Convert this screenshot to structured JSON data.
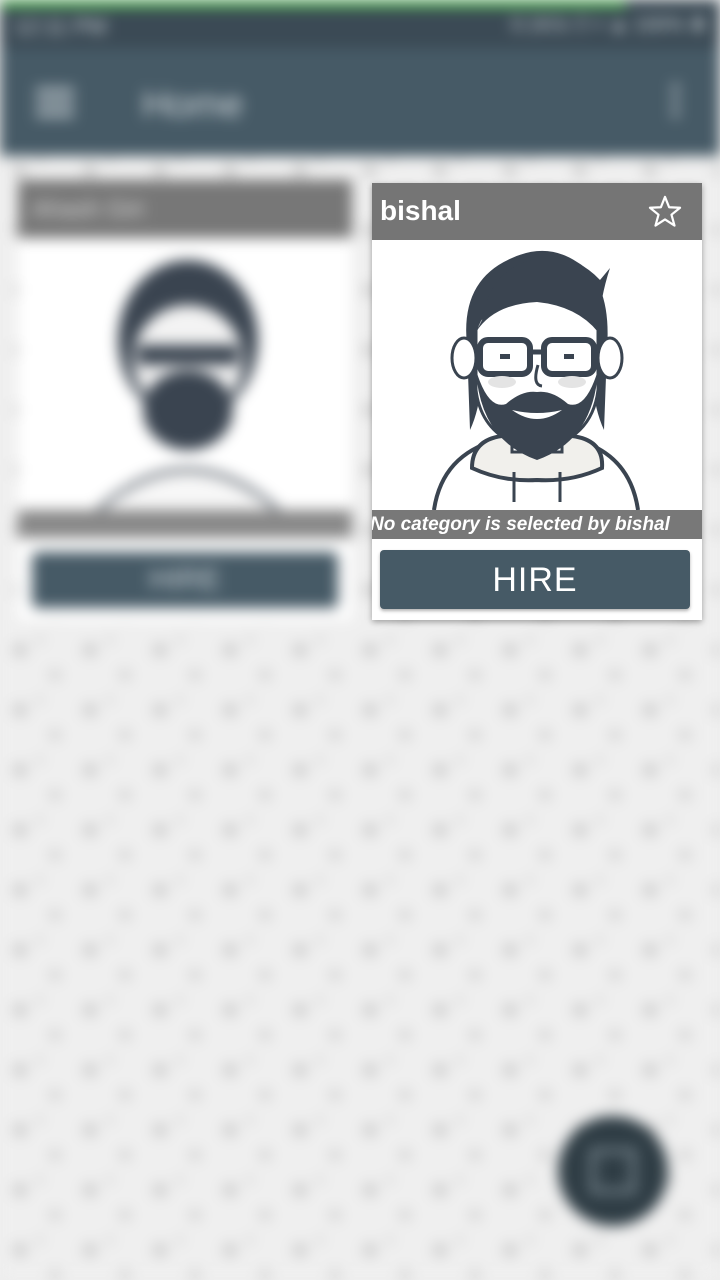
{
  "status_bar": {
    "time": "12:11 PM",
    "right_info": "0.1K/s ⏱ ▾ ▲ 100% ▮",
    "progress": 0.87
  },
  "app_bar": {
    "title": "Home",
    "menu_icon": "menu-icon",
    "overflow_icon": "more-vert-icon"
  },
  "cards": [
    {
      "name": "Ahash Giri",
      "hire_label": "HIRE",
      "blurred": true
    },
    {
      "name": "bishal",
      "caption": "No category is selected by bishal",
      "hire_label": "HIRE",
      "favorite_icon": "star-outline-icon",
      "blurred": false
    }
  ],
  "fab": {
    "icon": "grid-icon"
  },
  "colors": {
    "primary": "#465a66",
    "header_grey": "#757575",
    "background": "#eeeeee"
  }
}
